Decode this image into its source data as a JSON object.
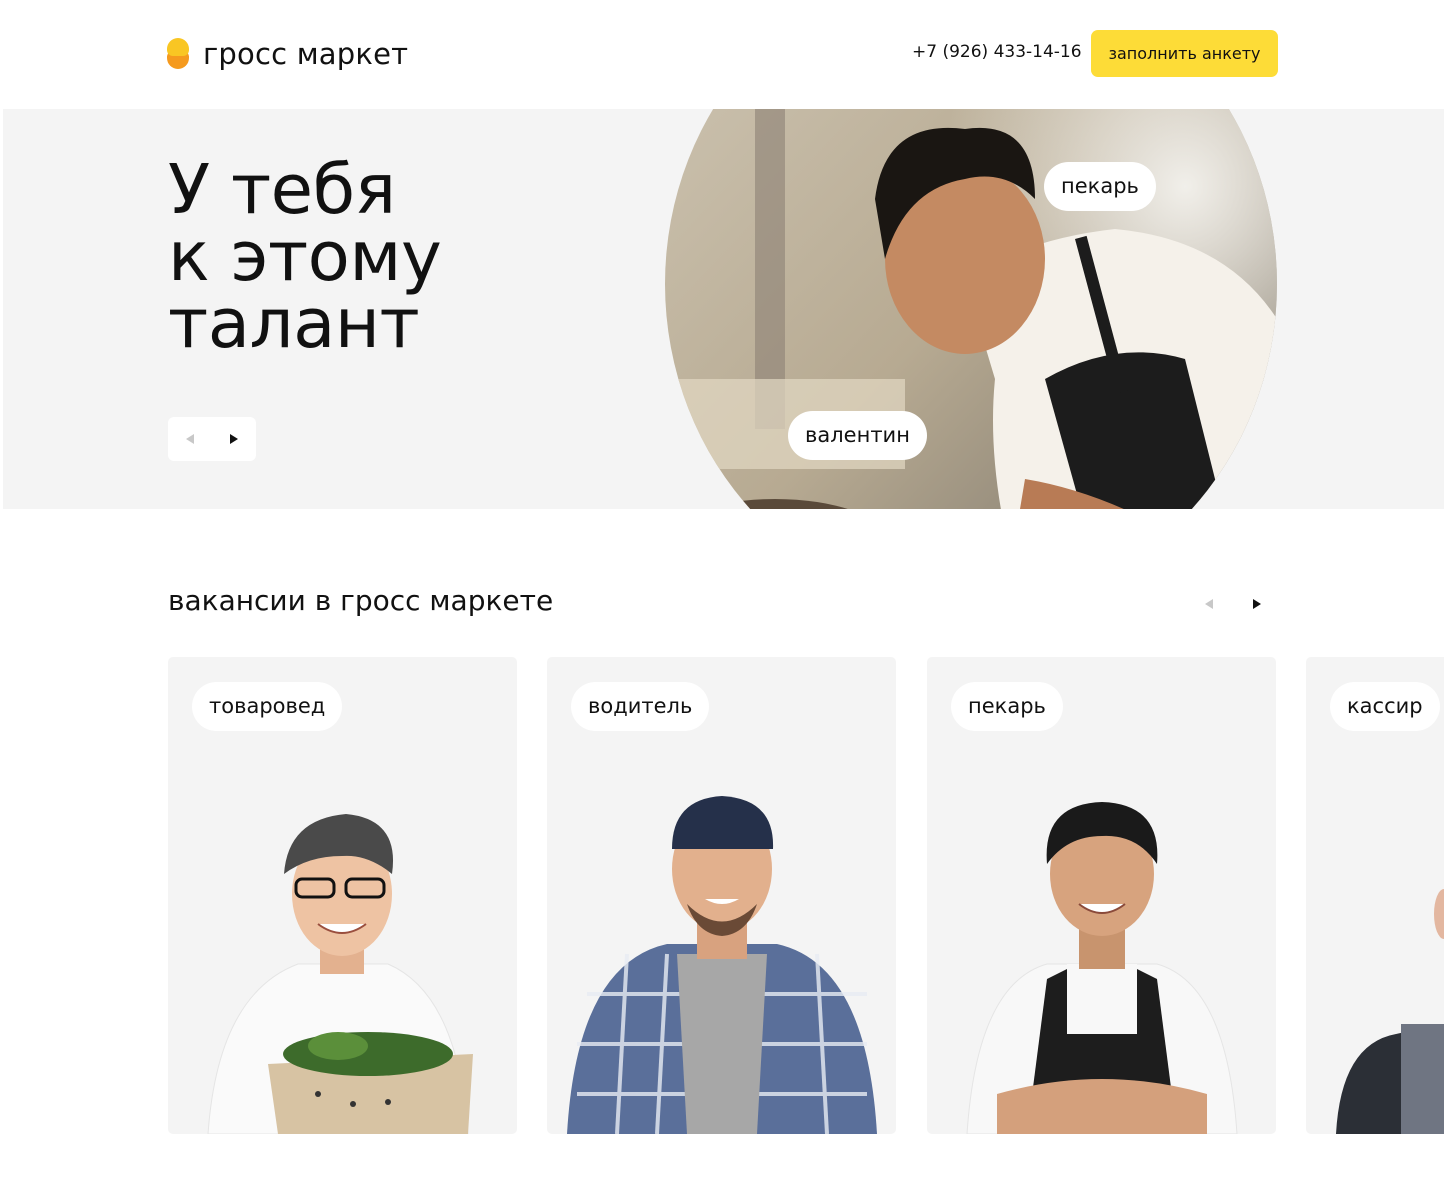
{
  "header": {
    "logo_text": "гросс маркет",
    "phone": "+7 (926) 433-14-16",
    "cta_label": "заполнить анкету"
  },
  "hero": {
    "title_lines": [
      "У тебя",
      "к этому",
      "талант"
    ],
    "role_tag": "пекарь",
    "name_tag": "валентин"
  },
  "vacancies": {
    "title": "вакансии в гросс маркете",
    "cards": [
      {
        "label": "товаровед"
      },
      {
        "label": "водитель"
      },
      {
        "label": "пекарь"
      },
      {
        "label": "кассир"
      }
    ]
  },
  "colors": {
    "accent_yellow": "#fddc37",
    "logo_yellow": "#f9c623",
    "logo_orange": "#f59a1e",
    "panel_gray": "#f4f4f4"
  }
}
